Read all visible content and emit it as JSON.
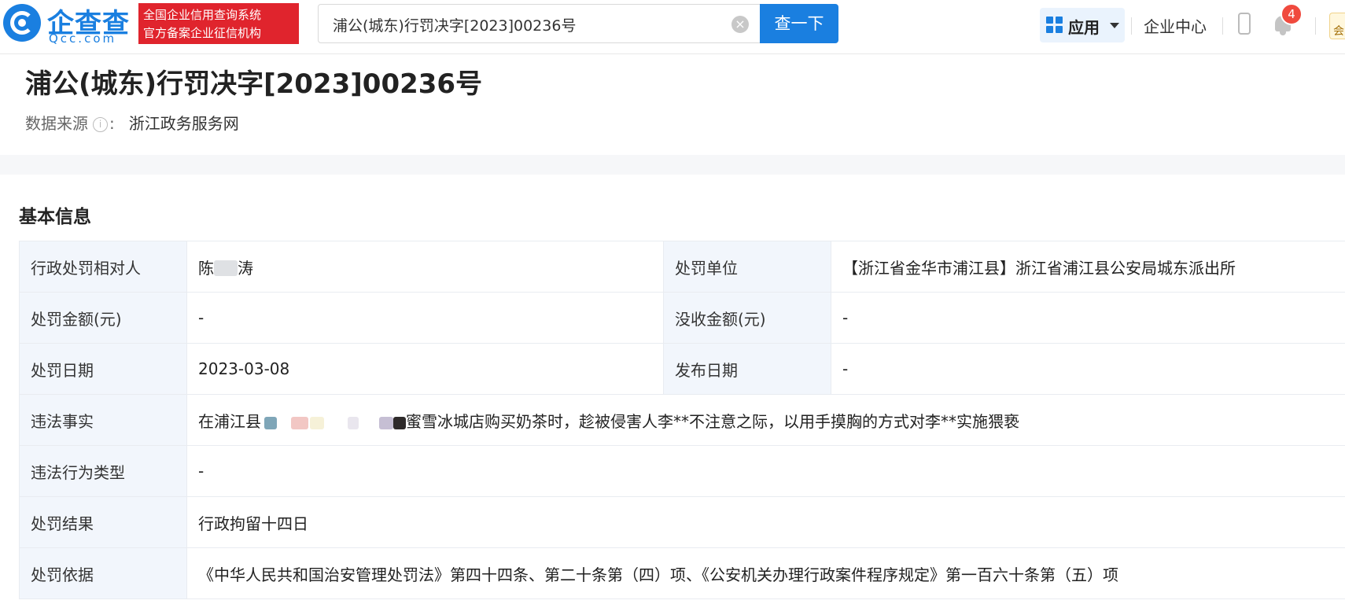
{
  "header": {
    "logo_cn": "企查查",
    "logo_en": "Qcc.com",
    "badge_line1": "全国企业信用查询系统",
    "badge_line2": "官方备案企业征信机构",
    "search_value": "浦公(城东)行罚决字[2023]00236号",
    "search_button": "查一下",
    "apps_label": "应用",
    "enterprise_center": "企业中心",
    "notification_count": "4",
    "vip_label": "会",
    "brand_color": "#1a7fe0",
    "badge_color": "#e0242d"
  },
  "record": {
    "title": "浦公(城东)行罚决字[2023]00236号",
    "source_label": "数据来源",
    "source_colon": ":",
    "source_value": "浙江政务服务网"
  },
  "basic_info": {
    "section_title": "基本信息",
    "party_label": "行政处罚相对人",
    "party_value_prefix": "陈",
    "party_value_suffix": "涛",
    "authority_label": "处罚单位",
    "authority_value": "【浙江省金华市浦江县】浙江省浦江县公安局城东派出所",
    "fine_label": "处罚金额(元)",
    "fine_value": "-",
    "confiscation_label": "没收金额(元)",
    "confiscation_value": "-",
    "date_label": "处罚日期",
    "date_value": "2023-03-08",
    "publish_label": "发布日期",
    "publish_value": "-",
    "facts_label": "违法事实",
    "facts_prefix": "在浦江县",
    "facts_suffix": "蜜雪冰城店购买奶茶时，趁被侵害人李**不注意之际，以用手摸胸的方式对李**实施猥亵",
    "violation_type_label": "违法行为类型",
    "violation_type_value": "-",
    "result_label": "处罚结果",
    "result_value": "行政拘留十四日",
    "basis_label": "处罚依据",
    "basis_value": "《中华人民共和国治安管理处罚法》第四十四条、第二十条第（四）项、《公安机关办理行政案件程序规定》第一百六十条第（五）项"
  }
}
